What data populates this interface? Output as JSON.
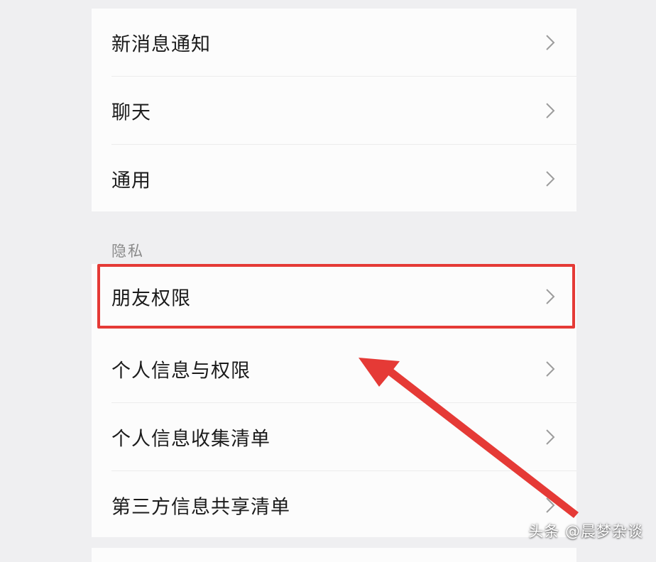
{
  "settings": {
    "items_top": [
      {
        "label": "新消息通知"
      },
      {
        "label": "聊天"
      },
      {
        "label": "通用"
      }
    ],
    "privacy_section": {
      "title": "隐私",
      "items": [
        {
          "label": "朋友权限"
        },
        {
          "label": "个人信息与权限"
        },
        {
          "label": "个人信息收集清单"
        },
        {
          "label": "第三方信息共享清单"
        }
      ]
    }
  },
  "annotation": {
    "highlight_color": "#e53a36",
    "icon": "chevron-right-icon"
  },
  "watermark": {
    "text": "头条 @晨梦杂谈"
  }
}
